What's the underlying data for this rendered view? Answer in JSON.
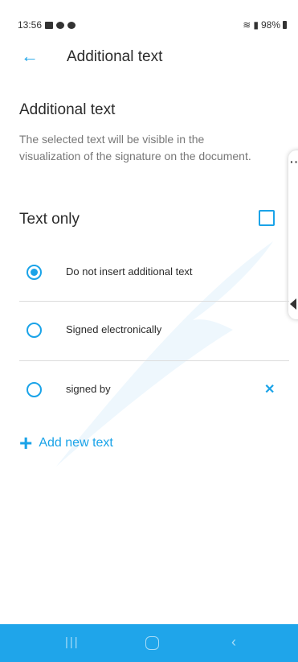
{
  "status_bar": {
    "time": "13:56",
    "battery": "98%"
  },
  "app_bar": {
    "title": "Additional text"
  },
  "section": {
    "heading": "Additional text",
    "description": "The selected text will be visible in the visualization of the signature on the document."
  },
  "text_only": {
    "label": "Text only",
    "checked": false
  },
  "options": [
    {
      "label": "Do not insert additional text",
      "selected": true,
      "removable": false
    },
    {
      "label": "Signed electronically",
      "selected": false,
      "removable": false
    },
    {
      "label": "signed by",
      "selected": false,
      "removable": true
    }
  ],
  "add_new": {
    "label": "Add new text"
  },
  "colors": {
    "accent": "#1aa3e8",
    "navbar": "#1fa5ea"
  }
}
